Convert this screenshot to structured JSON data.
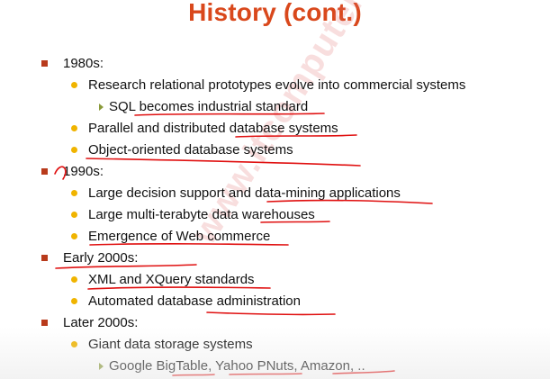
{
  "slide": {
    "title": "History (cont.)",
    "watermark": "www.itcomputer.com",
    "items": [
      {
        "level": 1,
        "text": "1980s:"
      },
      {
        "level": 2,
        "text": "Research relational prototypes evolve into commercial systems"
      },
      {
        "level": 3,
        "text": "SQL becomes industrial  standard"
      },
      {
        "level": 2,
        "text": "Parallel and distributed database systems"
      },
      {
        "level": 2,
        "text": "Object-oriented database systems"
      },
      {
        "level": 1,
        "text": "1990s:"
      },
      {
        "level": 2,
        "text": "Large decision support and data-mining applications"
      },
      {
        "level": 2,
        "text": "Large multi-terabyte data warehouses"
      },
      {
        "level": 2,
        "text": "Emergence of Web commerce"
      },
      {
        "level": 1,
        "text": "Early 2000s:"
      },
      {
        "level": 2,
        "text": "XML and XQuery standards"
      },
      {
        "level": 2,
        "text": "Automated database administration"
      },
      {
        "level": 1,
        "text": "Later 2000s:"
      },
      {
        "level": 2,
        "text": "Giant data storage systems"
      },
      {
        "level": 3,
        "text": "Google BigTable, Yahoo PNuts, Amazon, .."
      }
    ]
  },
  "colors": {
    "title": "#d9481c",
    "bullet_level1": "#b83a1b",
    "bullet_level2": "#f0b400",
    "bullet_level3": "#8a9a3a",
    "annotation_ink": "#e01010"
  }
}
